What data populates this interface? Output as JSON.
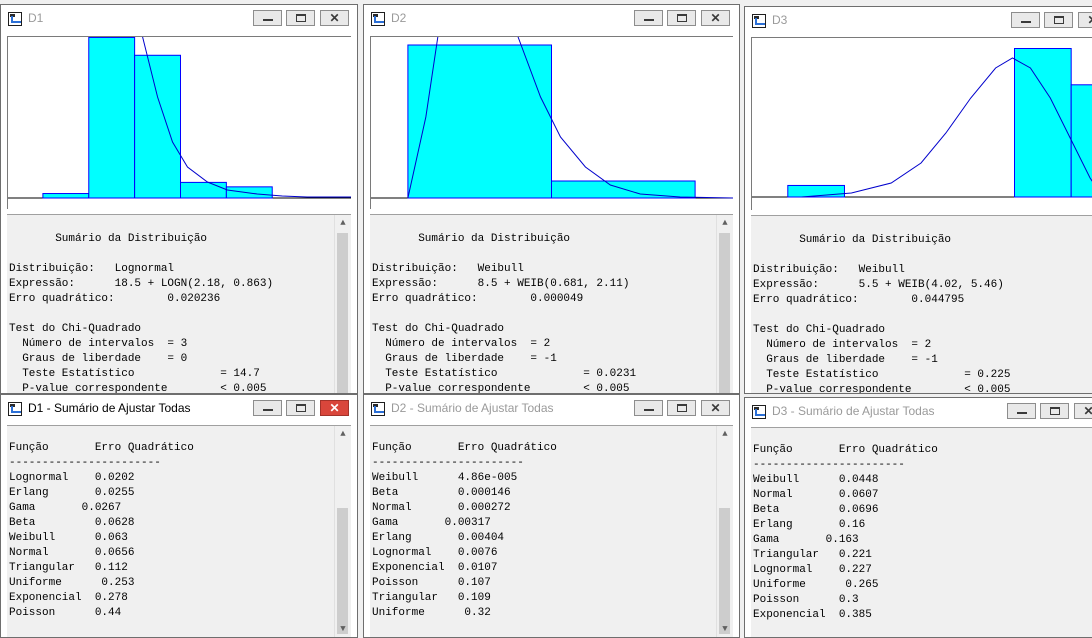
{
  "colors": {
    "bar_fill": "#00ffff",
    "bar_stroke": "#0000ff",
    "curve": "#0000cc"
  },
  "icons": {
    "app": "distribution-window-icon",
    "summary": "document-list-icon"
  },
  "top_windows": [
    {
      "title": "D1",
      "chart_data": {
        "type": "bar",
        "bins": [
          0.02,
          0.72,
          0.64,
          0.07,
          0.05
        ],
        "overlay": "lognormal density curve",
        "note": "histogram with fitted density; axes unlabeled"
      },
      "summary_lines": [
        "       Sumário da Distribuição",
        "",
        "Distribuição:   Lognormal",
        "Expressão:      18.5 + LOGN(2.18, 0.863)",
        "Erro quadrático:        0.020236",
        "",
        "Test do Chi-Quadrado",
        "  Número de intervalos  = 3",
        "  Graus de liberdade    = 0",
        "  Teste Estatístico             = 14.7",
        "  P-value correspondente        < 0.005"
      ]
    },
    {
      "title": "D2",
      "chart_data": {
        "type": "bar",
        "bins": [
          0.9,
          0.1
        ],
        "overlay": "weibull density curve",
        "note": "histogram with fitted density; axes unlabeled"
      },
      "summary_lines": [
        "       Sumário da Distribuição",
        "",
        "Distribuição:   Weibull",
        "Expressão:      8.5 + WEIB(0.681, 2.11)",
        "Erro quadrático:        0.000049",
        "",
        "Test do Chi-Quadrado",
        "  Número de intervalos  = 2",
        "  Graus de liberdade    = -1",
        "  Teste Estatístico             = 0.0231",
        "  P-value correspondente        < 0.005"
      ]
    },
    {
      "title": "D3",
      "chart_data": {
        "type": "bar",
        "bins": [
          0.07,
          0,
          0,
          0,
          0.9,
          0.68
        ],
        "overlay": "weibull density curve",
        "note": "histogram with fitted density; axes unlabeled"
      },
      "summary_lines": [
        "       Sumário da Distribuição",
        "",
        "Distribuição:   Weibull",
        "Expressão:      5.5 + WEIB(4.02, 5.46)",
        "Erro quadrático:        0.044795",
        "",
        "Test do Chi-Quadrado",
        "  Número de intervalos  = 2",
        "  Graus de liberdade    = -1",
        "  Teste Estatístico             = 0.225",
        "  P-value correspondente        < 0.005"
      ]
    }
  ],
  "fit_windows": [
    {
      "title": "D1 - Sumário de Ajustar Todas",
      "header": "Função       Erro Quadrático",
      "separator": "-----------------------",
      "rows": [
        "Lognormal    0.0202",
        "Erlang       0.0255",
        "Gama       0.0267",
        "Beta         0.0628",
        "Weibull      0.063",
        "Normal       0.0656",
        "Triangular   0.112",
        "Uniforme      0.253",
        "Exponencial  0.278",
        "Poisson      0.44"
      ]
    },
    {
      "title": "D2 - Sumário de Ajustar Todas",
      "header": "Função       Erro Quadrático",
      "separator": "-----------------------",
      "rows": [
        "Weibull      4.86e-005",
        "Beta         0.000146",
        "Normal       0.000272",
        "Gama       0.00317",
        "Erlang       0.00404",
        "Lognormal    0.0076",
        "Exponencial  0.0107",
        "Poisson      0.107",
        "Triangular   0.109",
        "Uniforme      0.32"
      ]
    },
    {
      "title": "D3 - Sumário de Ajustar Todas",
      "header": "Função       Erro Quadrático",
      "separator": "-----------------------",
      "rows": [
        "Weibull      0.0448",
        "Normal       0.0607",
        "Beta         0.0696",
        "Erlang       0.16",
        "Gama       0.163",
        "Triangular   0.221",
        "Lognormal    0.227",
        "Uniforme      0.265",
        "Poisson      0.3",
        "Exponencial  0.385"
      ]
    }
  ]
}
